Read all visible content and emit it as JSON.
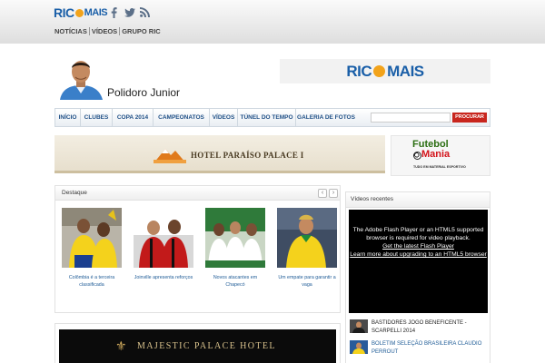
{
  "topbar": {
    "logo_ric": "RIC",
    "logo_mais": "MAIS",
    "nav": [
      "NOTÍCIAS",
      "VÍDEOS",
      "GRUPO RIC"
    ],
    "social_icons": [
      "facebook-icon",
      "twitter-icon",
      "rss-icon"
    ]
  },
  "header": {
    "title": "Polidoro Junior",
    "brand_ric": "RIC",
    "brand_mais": "MAIS"
  },
  "nav": {
    "items": [
      "INÍCIO",
      "CLUBES",
      "COPA 2014",
      "CAMPEONATOS",
      "VÍDEOS",
      "TÚNEL DO TEMPO",
      "GALERIA DE FOTOS"
    ],
    "search_placeholder": "",
    "search_button": "PROCURAR"
  },
  "ads": {
    "hotel": "HOTEL PARAÍSO PALACE I",
    "futebol_word1": "Futebol",
    "futebol_word2": "Mania",
    "futebol_tag": "TUDO EM MATERIAL ESPORTIVO",
    "majestic": "MAJESTIC  PALACE HOTEL"
  },
  "destaque": {
    "title": "Destaque",
    "prev": "‹",
    "next": "›",
    "items": [
      {
        "caption": "Colômbia é a terceira classificada"
      },
      {
        "caption": "Joinville apresenta reforços"
      },
      {
        "caption": "Novos atacantes em Chapecó"
      },
      {
        "caption": "Um empate para garantir a vaga"
      }
    ]
  },
  "videos": {
    "title": "Vídeos recentes",
    "player_msg_1": "The Adobe Flash Player or an HTML5 supported browser is required for video playback.",
    "player_link_1": "Get the latest Flash Player",
    "player_link_2": "Learn more about upgrading to an HTML5 browser",
    "items": [
      {
        "title": "BASTIDORES JOGO BENEFICENTE - SCARPELLI 2014"
      },
      {
        "title": "BOLETIM SELEÇÃO BRASILEIRA CLAUDIO PERROUT"
      }
    ]
  },
  "colors": {
    "brand_blue": "#1a5fa8",
    "brand_orange": "#f2a31b",
    "nav_text": "#1e4f86",
    "search_button": "#c8261e"
  }
}
